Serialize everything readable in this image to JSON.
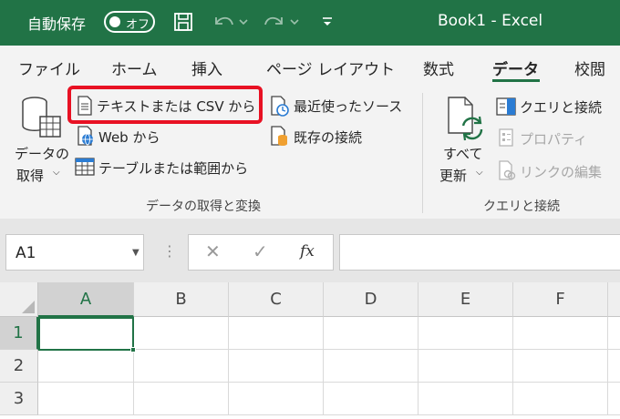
{
  "titlebar": {
    "autosave_label": "自動保存",
    "autosave_state": "オフ",
    "document_title": "Book1  -  Excel",
    "icons": [
      "save-icon",
      "undo-icon",
      "redo-icon",
      "customize-qat-icon"
    ]
  },
  "tabs": [
    {
      "label": "ファイル",
      "active": false
    },
    {
      "label": "ホーム",
      "active": false
    },
    {
      "label": "挿入",
      "active": false
    },
    {
      "label": "ページ レイアウト",
      "active": false
    },
    {
      "label": "数式",
      "active": false
    },
    {
      "label": "データ",
      "active": true
    },
    {
      "label": "校閲",
      "active": false
    }
  ],
  "ribbon": {
    "get_data": {
      "line1": "データの",
      "line2": "取得",
      "icon": "database-icon"
    },
    "from_text_csv": {
      "label": "テキストまたは CSV から",
      "icon": "text-file-icon",
      "highlighted": true
    },
    "from_web": {
      "label": "Web から",
      "icon": "web-icon"
    },
    "from_table": {
      "label": "テーブルまたは範囲から",
      "icon": "table-icon"
    },
    "recent_sources": {
      "label": "最近使ったソース",
      "icon": "recent-sources-icon"
    },
    "existing_connections": {
      "label": "既存の接続",
      "icon": "existing-connections-icon"
    },
    "group1_label": "データの取得と変換",
    "refresh_all": {
      "line1": "すべて",
      "line2": "更新",
      "icon": "refresh-icon"
    },
    "queries_connections": {
      "label": "クエリと接続",
      "icon": "queries-icon"
    },
    "properties": {
      "label": "プロパティ",
      "icon": "properties-icon",
      "disabled": true
    },
    "edit_links": {
      "label": "リンクの編集",
      "icon": "edit-links-icon",
      "disabled": true
    },
    "group2_label": "クエリと接続"
  },
  "formula_bar": {
    "name_box": "A1",
    "cancel_glyph": "✕",
    "enter_glyph": "✓",
    "fx_label": "fx",
    "formula": ""
  },
  "grid": {
    "columns": [
      "A",
      "B",
      "C",
      "D",
      "E",
      "F"
    ],
    "rows": [
      "1",
      "2",
      "3"
    ],
    "active_cell": "A1"
  },
  "colors": {
    "accent": "#217346",
    "highlight_border": "#e81123",
    "ribbon_bg": "#f3f3f3"
  }
}
